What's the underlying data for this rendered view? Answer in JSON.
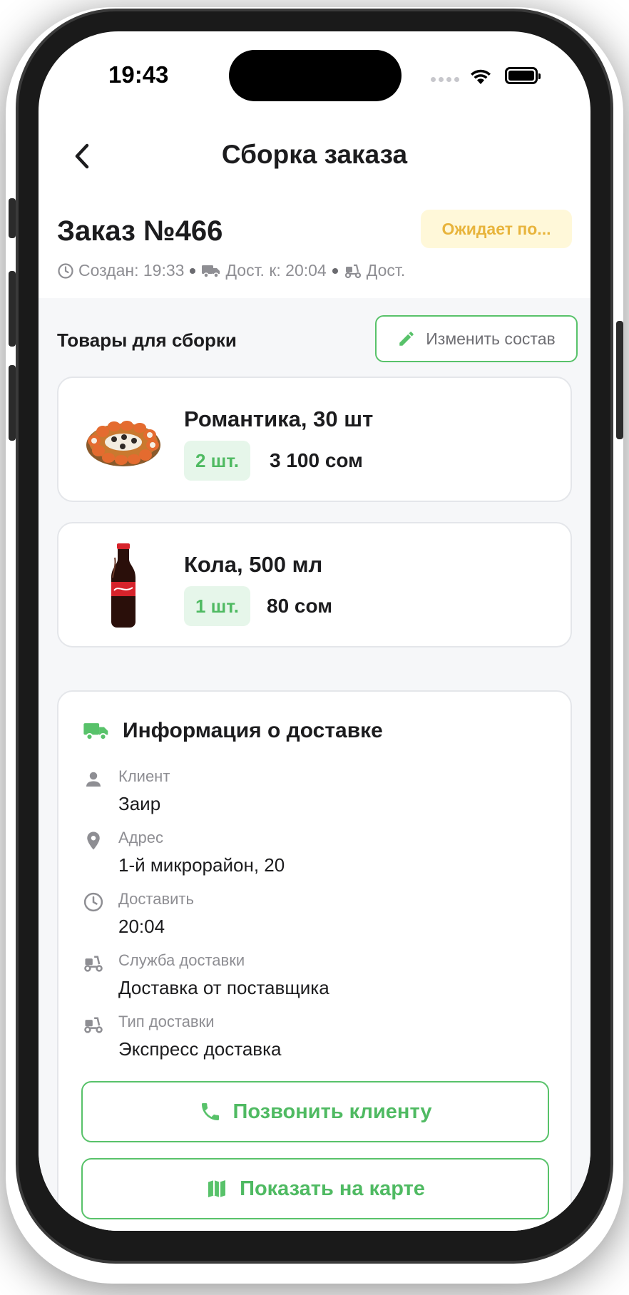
{
  "status_bar": {
    "time": "19:43"
  },
  "header": {
    "title": "Сборка заказа"
  },
  "order": {
    "title": "Заказ №466",
    "status": "Ожидает по...",
    "created": "Создан: 19:33",
    "delivery_time": "Дост. к: 20:04",
    "delivery_mode": "Дост."
  },
  "items_section": {
    "title": "Товары для сборки",
    "edit_label": "Изменить состав",
    "items": [
      {
        "name": "Романтика, 30 шт",
        "qty": "2 шт.",
        "price": "3 100 сом",
        "image_icon": "sushi-roll-set"
      },
      {
        "name": "Кола, 500 мл",
        "qty": "1 шт.",
        "price": "80 сом",
        "image_icon": "cola-bottle"
      }
    ]
  },
  "delivery": {
    "title": "Информация о доставке",
    "rows": [
      {
        "label": "Клиент",
        "value": "Заир",
        "icon": "person-icon"
      },
      {
        "label": "Адрес",
        "value": "1-й микрорайон, 20",
        "icon": "location-pin-icon"
      },
      {
        "label": "Доставить",
        "value": "20:04",
        "icon": "clock-icon"
      },
      {
        "label": "Служба доставки",
        "value": "Доставка от поставщика",
        "icon": "scooter-icon"
      },
      {
        "label": "Тип доставки",
        "value": "Экспресс доставка",
        "icon": "scooter-icon"
      }
    ],
    "call_label": "Позвонить клиенту",
    "map_label": "Показать на карте"
  },
  "colors": {
    "accent": "#58c26a",
    "accent_text": "#4fba62",
    "badge_bg": "#fff8d9",
    "badge_text": "#e8b43c",
    "qty_bg": "#e6f6ea"
  }
}
